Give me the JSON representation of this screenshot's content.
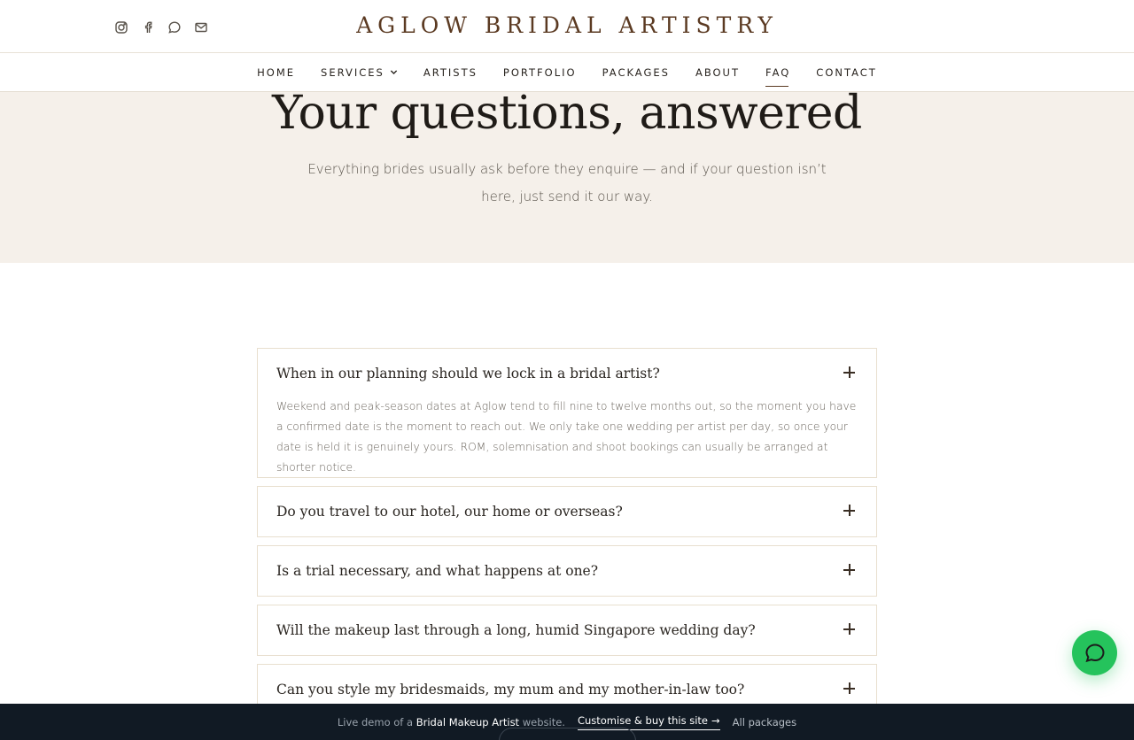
{
  "brand": {
    "name": "AGLOW BRIDAL ARTISTRY"
  },
  "socials": [
    {
      "icon": "instagram-icon"
    },
    {
      "icon": "facebook-icon"
    },
    {
      "icon": "chat-bubble-icon"
    },
    {
      "icon": "mail-icon"
    }
  ],
  "nav": {
    "items": [
      {
        "label": "HOME"
      },
      {
        "label": "SERVICES",
        "has_dropdown": true
      },
      {
        "label": "ARTISTS"
      },
      {
        "label": "PORTFOLIO"
      },
      {
        "label": "PACKAGES"
      },
      {
        "label": "ABOUT"
      },
      {
        "label": "FAQ",
        "active": true
      },
      {
        "label": "CONTACT"
      }
    ]
  },
  "hero": {
    "title": "Your questions, answered",
    "subtitle": "Everything brides usually ask before they enquire — and if your question isn’t here, just send it our way."
  },
  "faq": [
    {
      "question": "When in our planning should we lock in a bridal artist?",
      "answer": "Weekend and peak-season dates at Aglow tend to fill nine to twelve months out, so the moment you have a confirmed date is the moment to reach out. We only take one wedding per artist per day, so once your date is held it is genuinely yours. ROM, solemnisation and shoot bookings can usually be arranged at shorter notice.",
      "open": true
    },
    {
      "question": "Do you travel to our hotel, our home or overseas?",
      "open": false
    },
    {
      "question": "Is a trial necessary, and what happens at one?",
      "open": false
    },
    {
      "question": "Will the makeup last through a long, humid Singapore wedding day?",
      "open": false
    },
    {
      "question": "Can you style my bridesmaids, my mum and my mother-in-law too?",
      "open": false
    }
  ],
  "bottom_bar": {
    "prefix": "Live demo of a",
    "site_type": "Bridal Makeup Artist",
    "suffix": "website.",
    "cta": "Customise & buy this site",
    "cta_arrow": "→",
    "all_packages": "All packages"
  },
  "colors": {
    "brand": "#5b3a22",
    "hero_bg": "#f5f0ea",
    "chat_green": "#25c35c",
    "bottom_bar_bg": "#111a24"
  }
}
